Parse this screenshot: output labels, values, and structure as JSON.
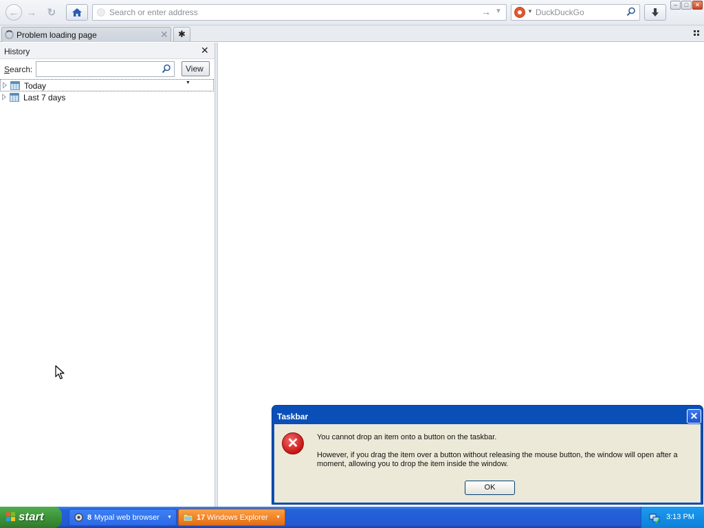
{
  "browser": {
    "address_bar": {
      "placeholder": "Search or enter address"
    },
    "search_bar": {
      "placeholder": "DuckDuckGo"
    },
    "tab": {
      "title": "Problem loading page"
    }
  },
  "sidebar": {
    "title": "History",
    "search_label": "Search:",
    "view_label": "View",
    "items": [
      {
        "label": "Today"
      },
      {
        "label": "Last 7 days"
      }
    ]
  },
  "dialog": {
    "title": "Taskbar",
    "message": "You cannot drop an item onto a button on the taskbar.",
    "detail": "However, if you drag the item over a button without releasing the mouse button, the window will open after a moment, allowing you to drop the item inside the window.",
    "ok_label": "OK"
  },
  "taskbar": {
    "start_label": "start",
    "buttons": [
      {
        "count": "8",
        "label": "Mypal web browser"
      },
      {
        "count": "17",
        "label": "Windows Explorer"
      }
    ],
    "clock": "3:13 PM"
  },
  "colors": {
    "taskbar_blue": "#2459d3",
    "start_green": "#3b8f36",
    "dialog_title_blue": "#0a4fb8",
    "dialog_body": "#ece9d8",
    "active_task_orange": "#e36d13",
    "error_red": "#c81414"
  },
  "icons": [
    "back-arrow-icon",
    "forward-arrow-icon",
    "reload-icon",
    "home-icon",
    "globe-icon",
    "go-arrow-icon",
    "dropdown-icon",
    "duckduckgo-icon",
    "search-icon",
    "download-icon",
    "loading-spinner-icon",
    "tab-close-icon",
    "new-tab-icon",
    "tab-list-icon",
    "close-icon",
    "expand-icon",
    "calendar-icon",
    "mouse-cursor-icon",
    "error-icon",
    "windows-flag-icon",
    "browser-icon",
    "folder-icon",
    "network-tray-icon"
  ]
}
